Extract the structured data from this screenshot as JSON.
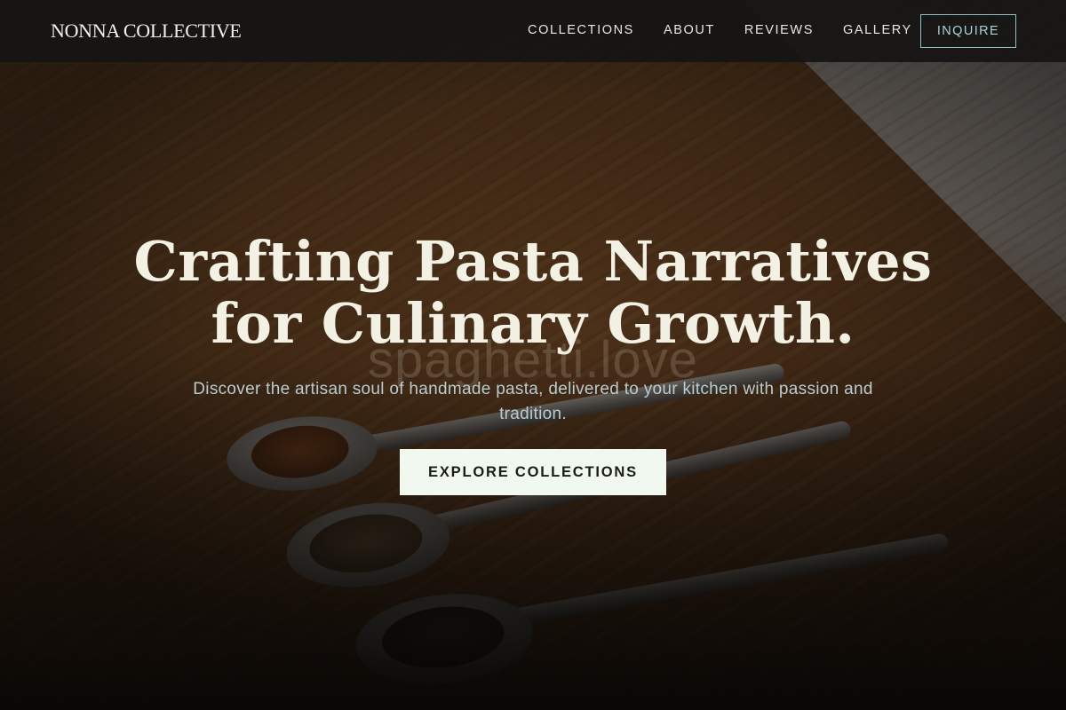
{
  "brand": {
    "name": "NONNA COLLECTIVE"
  },
  "nav": {
    "links": [
      "COLLECTIONS",
      "ABOUT",
      "REVIEWS",
      "GALLERY"
    ],
    "cta_label": "INQUIRE"
  },
  "hero": {
    "headline_line1": "Crafting Pasta Narratives",
    "headline_line2": "for Culinary Growth.",
    "watermark": "spaghetti.love",
    "subline": "Discover the artisan soul of handmade pasta, delivered to your kitchen with passion and tradition.",
    "cta_label": "EXPLORE COLLECTIONS",
    "background_image": "spoons-with-spices-on-wooden-table"
  },
  "colors": {
    "nav_bg": "#161413",
    "accent_outline": "#8fc1c4",
    "headline": "#f3f1e4",
    "cta_bg": "#f1f8ef"
  }
}
